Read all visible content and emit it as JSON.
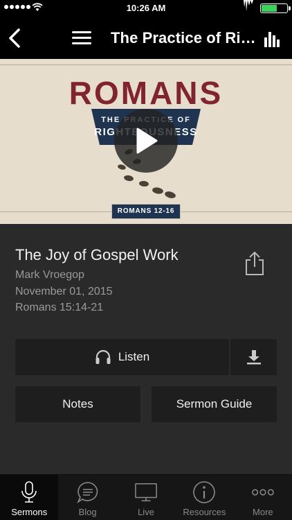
{
  "status_bar": {
    "time": "10:26 AM"
  },
  "nav": {
    "title": "The Practice of Righteousness",
    "back_icon": "chevron-left-icon",
    "menu_icon": "hamburger-menu-icon",
    "stats_icon": "bar-chart-icon"
  },
  "hero": {
    "series_title": "ROMANS",
    "subtitle_line1": "THE PRACTICE OF",
    "subtitle_line2": "RIGHTEOUSNESS",
    "passage_tag": "ROMANS 12-16",
    "colors": {
      "background": "#e7ddcc",
      "title": "#7f2430",
      "banner": "#1e3450"
    }
  },
  "sermon": {
    "title": "The Joy of Gospel Work",
    "speaker": "Mark Vroegop",
    "date": "November 01, 2015",
    "passage": "Romans 15:14-21"
  },
  "actions": {
    "listen_label": "Listen",
    "notes_label": "Notes",
    "guide_label": "Sermon Guide"
  },
  "tabs": [
    {
      "label": "Sermons",
      "icon": "microphone-icon",
      "active": true
    },
    {
      "label": "Blog",
      "icon": "chat-bubble-icon",
      "active": false
    },
    {
      "label": "Live",
      "icon": "tv-icon",
      "active": false
    },
    {
      "label": "Resources",
      "icon": "info-icon",
      "active": false
    },
    {
      "label": "More",
      "icon": "more-dots-icon",
      "active": false
    }
  ]
}
